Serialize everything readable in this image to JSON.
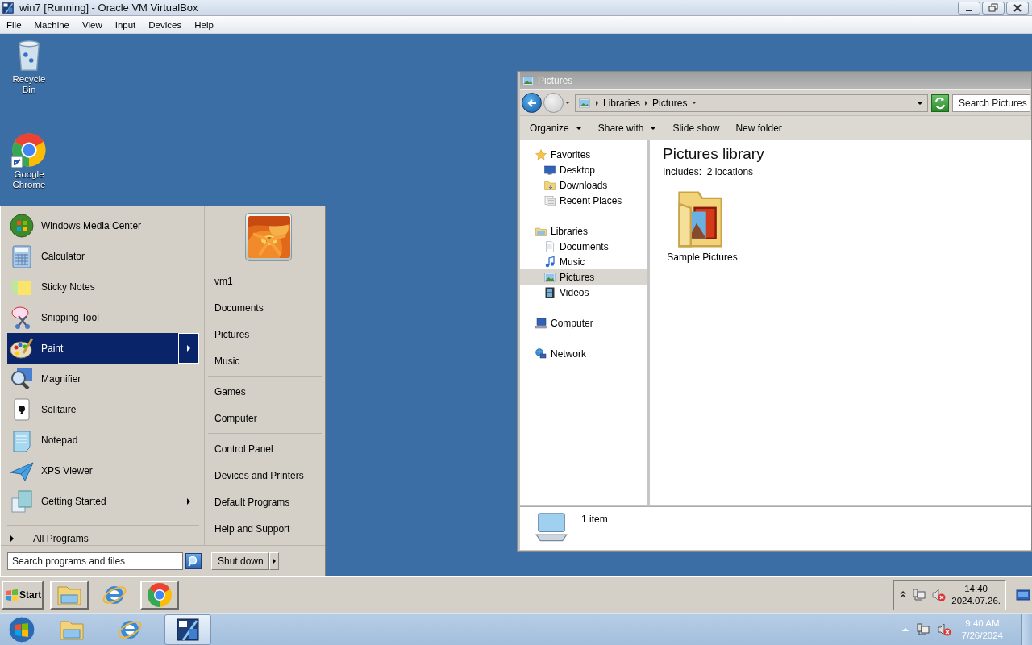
{
  "window": {
    "title": "win7 [Running] - Oracle VM VirtualBox"
  },
  "menu_bar": [
    "File",
    "Machine",
    "View",
    "Input",
    "Devices",
    "Help"
  ],
  "desktop_icons": [
    {
      "label": "Recycle Bin",
      "kind": "recycle",
      "shortcut": false
    },
    {
      "label": "Google Chrome",
      "kind": "chrome",
      "shortcut": true
    }
  ],
  "start_menu": {
    "programs": [
      {
        "label": "Windows Media Center",
        "kind": "mediacenter",
        "selected": false,
        "submenu": false
      },
      {
        "label": "Calculator",
        "kind": "calculator",
        "selected": false,
        "submenu": false
      },
      {
        "label": "Sticky Notes",
        "kind": "sticky",
        "selected": false,
        "submenu": false
      },
      {
        "label": "Snipping Tool",
        "kind": "scissors",
        "selected": false,
        "submenu": false
      },
      {
        "label": "Paint",
        "kind": "paint",
        "selected": true,
        "submenu": true
      },
      {
        "label": "Magnifier",
        "kind": "magnifier",
        "selected": false,
        "submenu": false
      },
      {
        "label": "Solitaire",
        "kind": "solitaire",
        "selected": false,
        "submenu": false
      },
      {
        "label": "Notepad",
        "kind": "notepad",
        "selected": false,
        "submenu": false
      },
      {
        "label": "XPS Viewer",
        "kind": "xps",
        "selected": false,
        "submenu": false
      },
      {
        "label": "Getting Started",
        "kind": "started",
        "selected": false,
        "submenu": true
      }
    ],
    "all_programs": "All Programs",
    "places": [
      [
        "vm1",
        "Documents",
        "Pictures",
        "Music"
      ],
      [
        "Games",
        "Computer"
      ],
      [
        "Control Panel",
        "Devices and Printers",
        "Default Programs",
        "Help and Support"
      ]
    ],
    "search": {
      "placeholder": "Search programs and files"
    },
    "shutdown": "Shut down"
  },
  "explorer": {
    "title": "Pictures",
    "breadcrumb": [
      "Libraries",
      "Pictures"
    ],
    "search": {
      "placeholder": "Search Pictures"
    },
    "toolbar": [
      {
        "label": "Organize",
        "dropdown": true
      },
      {
        "label": "Share with",
        "dropdown": true
      },
      {
        "label": "Slide show",
        "dropdown": false
      },
      {
        "label": "New folder",
        "dropdown": false
      }
    ],
    "nav_pane": [
      {
        "label": "Favorites",
        "kind": "star",
        "selected": false,
        "children": [
          {
            "label": "Desktop",
            "kind": "desktop",
            "selected": false
          },
          {
            "label": "Downloads",
            "kind": "downloads",
            "selected": false
          },
          {
            "label": "Recent Places",
            "kind": "recent",
            "selected": false
          }
        ]
      },
      {
        "label": "Libraries",
        "kind": "libraries",
        "selected": false,
        "children": [
          {
            "label": "Documents",
            "kind": "documents",
            "selected": false
          },
          {
            "label": "Music",
            "kind": "music",
            "selected": false
          },
          {
            "label": "Pictures",
            "kind": "pictures",
            "selected": true
          },
          {
            "label": "Videos",
            "kind": "videos",
            "selected": false
          }
        ]
      },
      {
        "label": "Computer",
        "kind": "computer",
        "selected": false
      },
      {
        "label": "Network",
        "kind": "network",
        "selected": false
      }
    ],
    "heading": "Pictures library",
    "subheading": "Includes:  2 locations",
    "items": [
      {
        "label": "Sample Pictures",
        "kind": "picfolder"
      }
    ],
    "status": "1 item"
  },
  "guest_taskbar": {
    "start": "Start",
    "apps": [
      {
        "kind": "explorer",
        "open": true
      },
      {
        "kind": "ie",
        "open": false
      },
      {
        "kind": "chrome",
        "open": true
      }
    ],
    "time": "14:40",
    "date": "2024.07.26."
  },
  "host_taskbar": {
    "apps": [
      {
        "kind": "explorer",
        "selected": false
      },
      {
        "kind": "ie",
        "selected": false
      },
      {
        "kind": "vbox",
        "selected": true
      }
    ],
    "time": "9:40 AM",
    "date": "7/26/2024"
  }
}
